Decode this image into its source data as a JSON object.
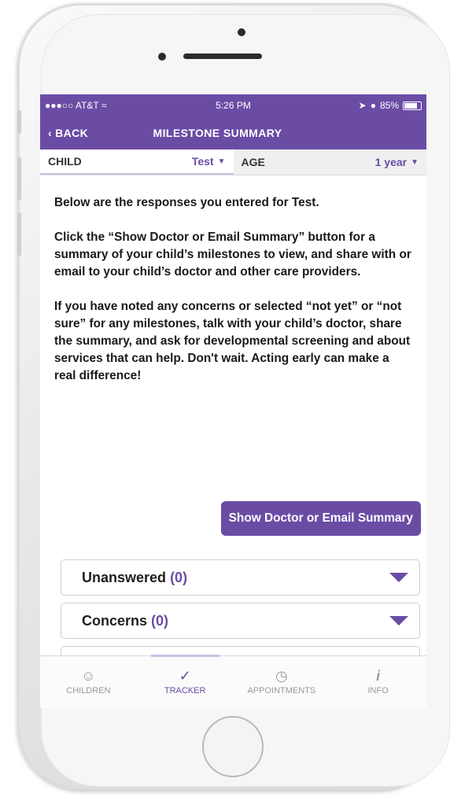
{
  "status_bar": {
    "carrier": "●●●○○ AT&T",
    "time": "5:26 PM",
    "battery": "85%"
  },
  "nav": {
    "back_label": "BACK",
    "title": "MILESTONE SUMMARY"
  },
  "selector": {
    "child_label": "CHILD",
    "child_value": "Test",
    "age_label": "AGE",
    "age_value": "1 year"
  },
  "content": {
    "intro": "Below are the responses you entered for Test.",
    "para2": "Click the “Show Doctor or Email Summary” button for a summary of your child’s milestones to view, and share with or email to your child’s doctor and other care providers.",
    "para3": "If you have noted any concerns or selected “not yet” or “not sure” for any milestones, talk with your child’s doctor, share the summary, and ask for developmental screening and about services that can help. Don't wait. Acting early can make a real difference!",
    "button_label": "Show Doctor or Email Summary"
  },
  "sections": [
    {
      "label": "Unanswered",
      "count": "(0)"
    },
    {
      "label": "Concerns",
      "count": "(0)"
    }
  ],
  "tabs": [
    {
      "label": "CHILDREN",
      "icon": "children-icon"
    },
    {
      "label": "TRACKER",
      "icon": "checkmark-icon"
    },
    {
      "label": "APPOINTMENTS",
      "icon": "clock-icon"
    },
    {
      "label": "INFO",
      "icon": "info-icon"
    }
  ],
  "colors": {
    "accent": "#6a4ca5",
    "tab_inactive": "#9a9a9a"
  }
}
